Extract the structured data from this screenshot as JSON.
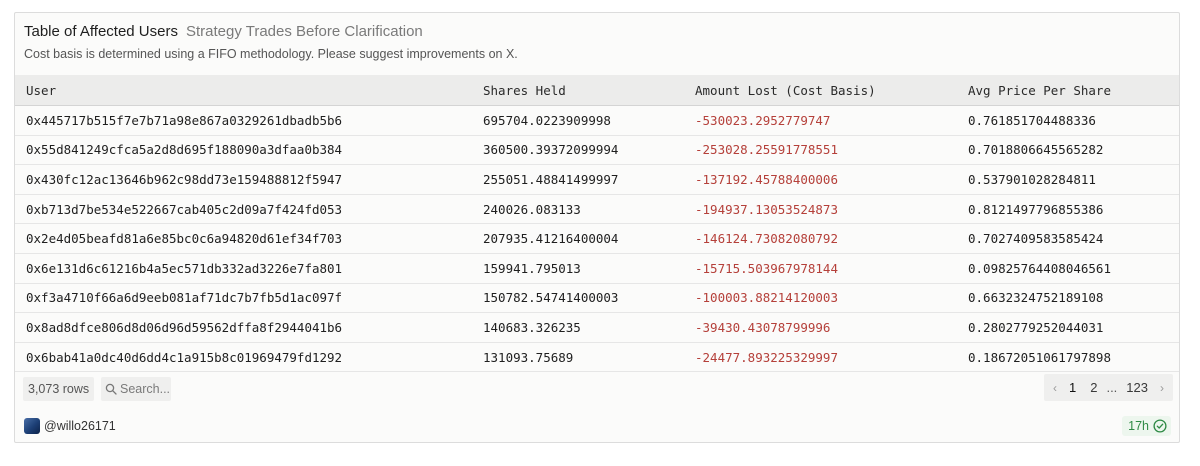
{
  "header": {
    "title": "Table of Affected Users",
    "subtitle": "Strategy Trades Before Clarification",
    "description": "Cost basis is determined using a FIFO methodology. Please suggest improvements on X."
  },
  "table": {
    "columns": [
      "User",
      "Shares Held",
      "Amount Lost (Cost Basis)",
      "Avg Price Per Share"
    ],
    "rows": [
      [
        "0x445717b515f7e7b71a98e867a0329261dbadb5b6",
        "695704.0223909998",
        "-530023.2952779747",
        "0.761851704488336"
      ],
      [
        "0x55d841249cfca5a2d8d695f188090a3dfaa0b384",
        "360500.39372099994",
        "-253028.25591778551",
        "0.7018806645565282"
      ],
      [
        "0x430fc12ac13646b962c98dd73e159488812f5947",
        "255051.48841499997",
        "-137192.45788400006",
        "0.537901028284811"
      ],
      [
        "0xb713d7be534e522667cab405c2d09a7f424fd053",
        "240026.083133",
        "-194937.13053524873",
        "0.8121497796855386"
      ],
      [
        "0x2e4d05beafd81a6e85bc0c6a94820d61ef34f703",
        "207935.41216400004",
        "-146124.73082080792",
        "0.7027409583585424"
      ],
      [
        "0x6e131d6c61216b4a5ec571db332ad3226e7fa801",
        "159941.795013",
        "-15715.503967978144",
        "0.09825764408046561"
      ],
      [
        "0xf3a4710f66a6d9eeb081af71dc7b7fb5d1ac097f",
        "150782.54741400003",
        "-100003.88214120003",
        "0.6632324752189108"
      ],
      [
        "0x8ad8dfce806d8d06d96d59562dffa8f2944041b6",
        "140683.326235",
        "-39430.43078799996",
        "0.2802779252044031"
      ],
      [
        "0x6bab41a0dc40d6dd4c1a915b8c01969479fd1292",
        "131093.75689",
        "-24477.893225329997",
        "0.18672051061797898"
      ]
    ]
  },
  "footer": {
    "row_count": "3,073 rows",
    "search_placeholder": "Search...",
    "pagination": {
      "prev_icon": "chevron-left-icon",
      "pages": [
        "1",
        "2"
      ],
      "ellipsis": "...",
      "last_page": "123",
      "current": "1",
      "next_icon": "chevron-right-icon"
    }
  },
  "attribution": {
    "handle": "@willo26171",
    "time": "17h",
    "verified_icon": "check-circle-icon"
  },
  "colors": {
    "negative": "#b5403a",
    "success": "#2f8a45",
    "header_bg": "#ececeb"
  }
}
